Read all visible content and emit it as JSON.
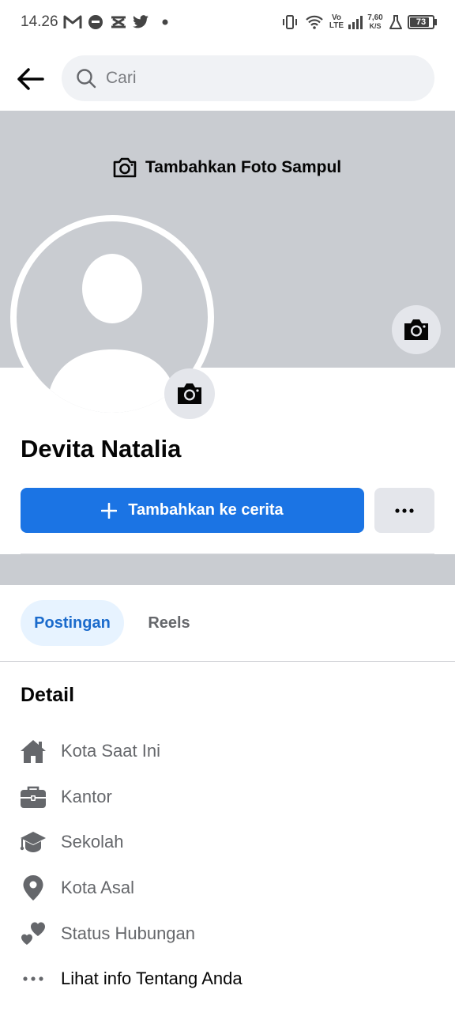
{
  "status_bar": {
    "time": "14.26",
    "network_top": "Vo",
    "network_bottom": "LTE",
    "speed_value": "7,60",
    "speed_unit": "K/S",
    "battery": "73"
  },
  "search": {
    "placeholder": "Cari"
  },
  "cover": {
    "add_cover_label": "Tambahkan Foto Sampul"
  },
  "profile": {
    "name": "Devita Natalia"
  },
  "actions": {
    "add_story_label": "Tambahkan ke cerita"
  },
  "tabs": [
    {
      "label": "Postingan",
      "selected": true
    },
    {
      "label": "Reels",
      "selected": false
    }
  ],
  "details": {
    "title": "Detail",
    "items": [
      {
        "label": "Kota Saat Ini",
        "icon": "home-icon"
      },
      {
        "label": "Kantor",
        "icon": "briefcase-icon"
      },
      {
        "label": "Sekolah",
        "icon": "graduation-cap-icon"
      },
      {
        "label": "Kota Asal",
        "icon": "location-pin-icon"
      },
      {
        "label": "Status Hubungan",
        "icon": "hearts-icon"
      },
      {
        "label": "Lihat info Tentang Anda",
        "icon": "more-dots-icon"
      }
    ]
  },
  "colors": {
    "primary": "#1b74e4",
    "cover": "#c9ccd1",
    "tab_selected_bg": "#e7f3ff",
    "muted_text": "#65676b"
  }
}
